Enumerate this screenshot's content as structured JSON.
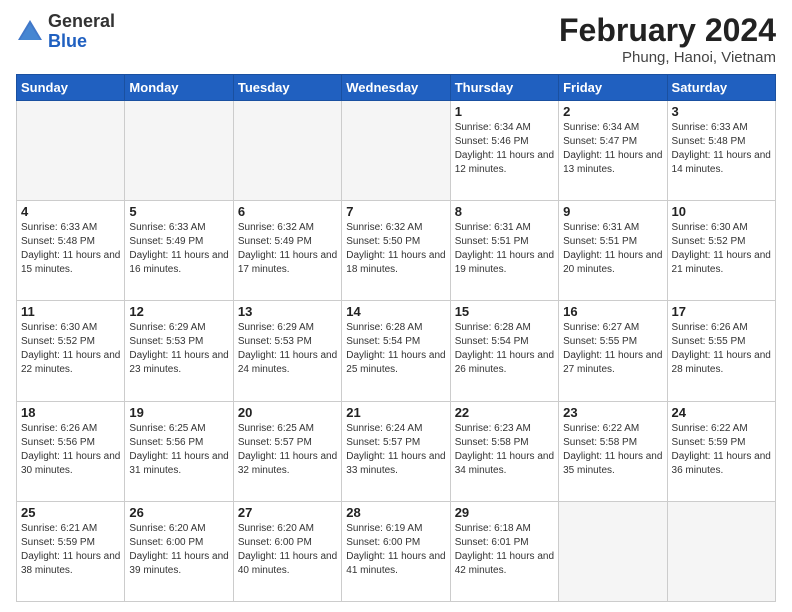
{
  "logo": {
    "general": "General",
    "blue": "Blue"
  },
  "title": {
    "month_year": "February 2024",
    "location": "Phung, Hanoi, Vietnam"
  },
  "days_of_week": [
    "Sunday",
    "Monday",
    "Tuesday",
    "Wednesday",
    "Thursday",
    "Friday",
    "Saturday"
  ],
  "weeks": [
    [
      {
        "day": "",
        "info": ""
      },
      {
        "day": "",
        "info": ""
      },
      {
        "day": "",
        "info": ""
      },
      {
        "day": "",
        "info": ""
      },
      {
        "day": "1",
        "info": "Sunrise: 6:34 AM\nSunset: 5:46 PM\nDaylight: 11 hours and 12 minutes."
      },
      {
        "day": "2",
        "info": "Sunrise: 6:34 AM\nSunset: 5:47 PM\nDaylight: 11 hours and 13 minutes."
      },
      {
        "day": "3",
        "info": "Sunrise: 6:33 AM\nSunset: 5:48 PM\nDaylight: 11 hours and 14 minutes."
      }
    ],
    [
      {
        "day": "4",
        "info": "Sunrise: 6:33 AM\nSunset: 5:48 PM\nDaylight: 11 hours and 15 minutes."
      },
      {
        "day": "5",
        "info": "Sunrise: 6:33 AM\nSunset: 5:49 PM\nDaylight: 11 hours and 16 minutes."
      },
      {
        "day": "6",
        "info": "Sunrise: 6:32 AM\nSunset: 5:49 PM\nDaylight: 11 hours and 17 minutes."
      },
      {
        "day": "7",
        "info": "Sunrise: 6:32 AM\nSunset: 5:50 PM\nDaylight: 11 hours and 18 minutes."
      },
      {
        "day": "8",
        "info": "Sunrise: 6:31 AM\nSunset: 5:51 PM\nDaylight: 11 hours and 19 minutes."
      },
      {
        "day": "9",
        "info": "Sunrise: 6:31 AM\nSunset: 5:51 PM\nDaylight: 11 hours and 20 minutes."
      },
      {
        "day": "10",
        "info": "Sunrise: 6:30 AM\nSunset: 5:52 PM\nDaylight: 11 hours and 21 minutes."
      }
    ],
    [
      {
        "day": "11",
        "info": "Sunrise: 6:30 AM\nSunset: 5:52 PM\nDaylight: 11 hours and 22 minutes."
      },
      {
        "day": "12",
        "info": "Sunrise: 6:29 AM\nSunset: 5:53 PM\nDaylight: 11 hours and 23 minutes."
      },
      {
        "day": "13",
        "info": "Sunrise: 6:29 AM\nSunset: 5:53 PM\nDaylight: 11 hours and 24 minutes."
      },
      {
        "day": "14",
        "info": "Sunrise: 6:28 AM\nSunset: 5:54 PM\nDaylight: 11 hours and 25 minutes."
      },
      {
        "day": "15",
        "info": "Sunrise: 6:28 AM\nSunset: 5:54 PM\nDaylight: 11 hours and 26 minutes."
      },
      {
        "day": "16",
        "info": "Sunrise: 6:27 AM\nSunset: 5:55 PM\nDaylight: 11 hours and 27 minutes."
      },
      {
        "day": "17",
        "info": "Sunrise: 6:26 AM\nSunset: 5:55 PM\nDaylight: 11 hours and 28 minutes."
      }
    ],
    [
      {
        "day": "18",
        "info": "Sunrise: 6:26 AM\nSunset: 5:56 PM\nDaylight: 11 hours and 30 minutes."
      },
      {
        "day": "19",
        "info": "Sunrise: 6:25 AM\nSunset: 5:56 PM\nDaylight: 11 hours and 31 minutes."
      },
      {
        "day": "20",
        "info": "Sunrise: 6:25 AM\nSunset: 5:57 PM\nDaylight: 11 hours and 32 minutes."
      },
      {
        "day": "21",
        "info": "Sunrise: 6:24 AM\nSunset: 5:57 PM\nDaylight: 11 hours and 33 minutes."
      },
      {
        "day": "22",
        "info": "Sunrise: 6:23 AM\nSunset: 5:58 PM\nDaylight: 11 hours and 34 minutes."
      },
      {
        "day": "23",
        "info": "Sunrise: 6:22 AM\nSunset: 5:58 PM\nDaylight: 11 hours and 35 minutes."
      },
      {
        "day": "24",
        "info": "Sunrise: 6:22 AM\nSunset: 5:59 PM\nDaylight: 11 hours and 36 minutes."
      }
    ],
    [
      {
        "day": "25",
        "info": "Sunrise: 6:21 AM\nSunset: 5:59 PM\nDaylight: 11 hours and 38 minutes."
      },
      {
        "day": "26",
        "info": "Sunrise: 6:20 AM\nSunset: 6:00 PM\nDaylight: 11 hours and 39 minutes."
      },
      {
        "day": "27",
        "info": "Sunrise: 6:20 AM\nSunset: 6:00 PM\nDaylight: 11 hours and 40 minutes."
      },
      {
        "day": "28",
        "info": "Sunrise: 6:19 AM\nSunset: 6:00 PM\nDaylight: 11 hours and 41 minutes."
      },
      {
        "day": "29",
        "info": "Sunrise: 6:18 AM\nSunset: 6:01 PM\nDaylight: 11 hours and 42 minutes."
      },
      {
        "day": "",
        "info": ""
      },
      {
        "day": "",
        "info": ""
      }
    ]
  ]
}
